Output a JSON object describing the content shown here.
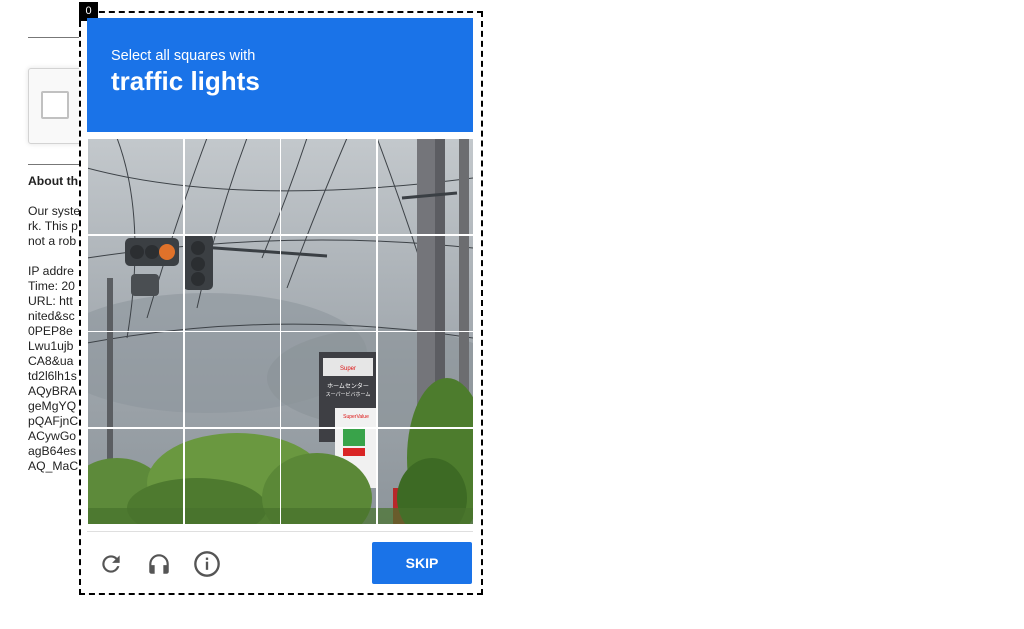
{
  "background": {
    "about_title": "About th",
    "about_body": "Our syste\nrk. This p\nnot a rob",
    "ip_lines": "IP addre\nTime: 20\nURL: htt\nnited&sc\n0PEP8e\nLwu1ujb\nCA8&ua\ntd2l6lh1s\nAQyBRA\ngeMgYQ\npQAFjnC\nACywGo\nagB64es\nAQ_MaC"
  },
  "dialog": {
    "index_badge": "0",
    "header_subtitle": "Select all squares with",
    "header_title": "traffic lights",
    "grid": {
      "rows": 4,
      "cols": 4
    },
    "buttons": {
      "reload_icon": "reload-icon",
      "audio_icon": "headphones-icon",
      "info_icon": "info-icon",
      "skip_label": "SKIP"
    },
    "image_text": {
      "sign_top": "Super",
      "sign_jp1": "ホームセンター",
      "sign_jp2": "スーパービバホーム",
      "sign_mid": "SuperValue"
    }
  },
  "colors": {
    "accent": "#1a73e8",
    "text": "#222222"
  }
}
